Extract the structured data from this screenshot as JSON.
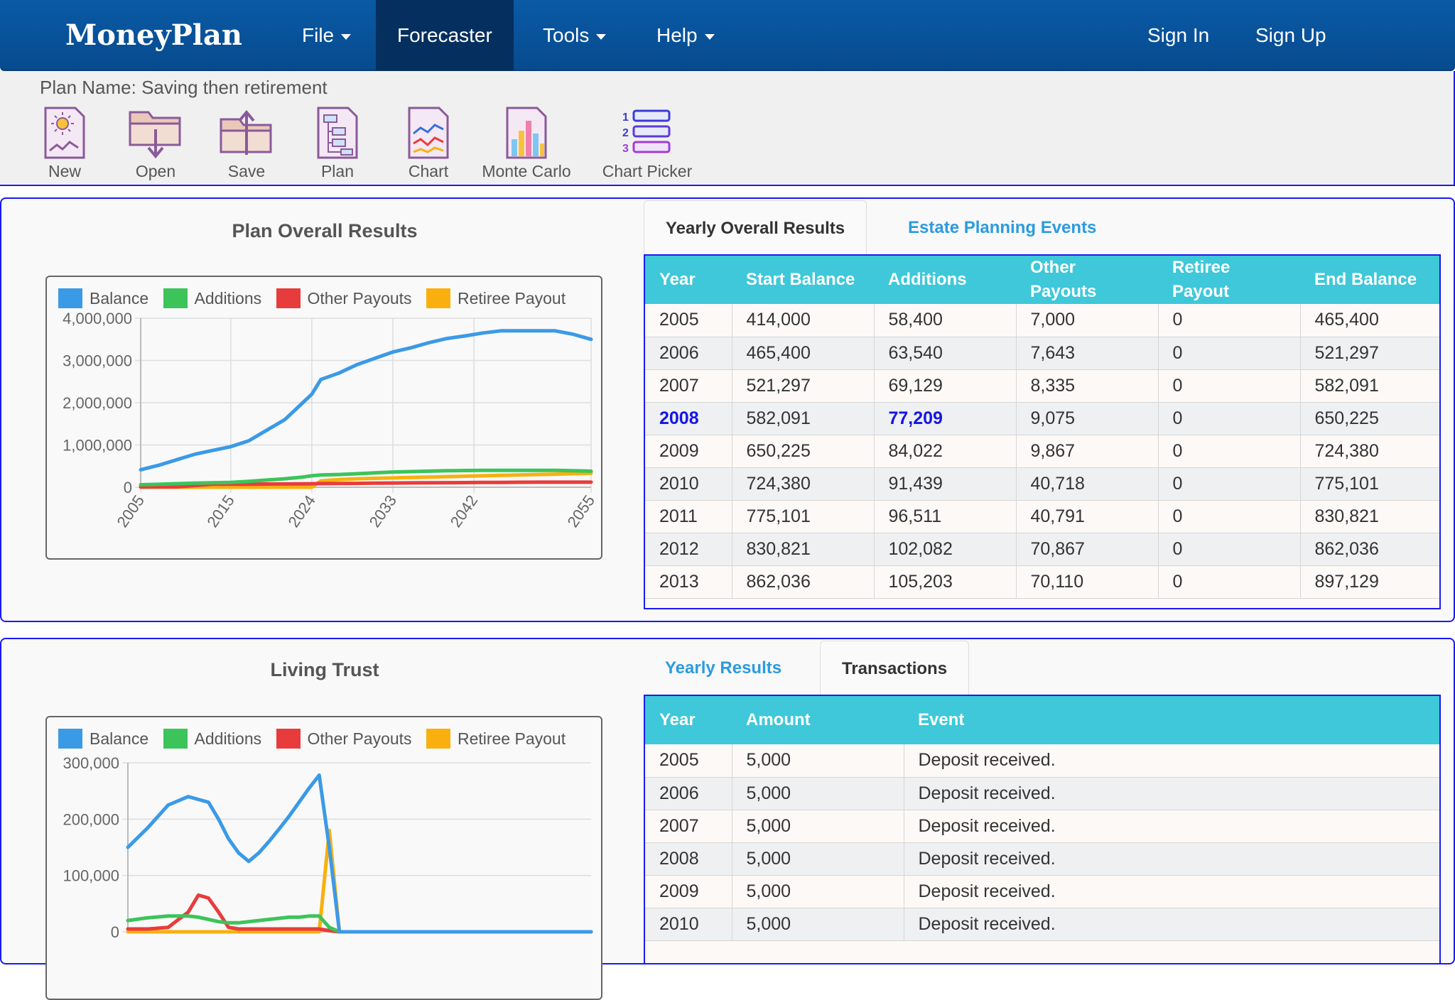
{
  "nav": {
    "brand": "MoneyPlan",
    "menu": [
      {
        "label": "File",
        "dropdown": true
      },
      {
        "label": "Forecaster",
        "dropdown": false,
        "active": true
      },
      {
        "label": "Tools",
        "dropdown": true
      },
      {
        "label": "Help",
        "dropdown": true
      }
    ],
    "sign_in": "Sign In",
    "sign_up": "Sign Up"
  },
  "toolbar": {
    "plan_name": "Plan Name: Saving then retirement",
    "tools": [
      {
        "label": "New",
        "icon": "new-plan-icon"
      },
      {
        "label": "Open",
        "icon": "open-folder-icon"
      },
      {
        "label": "Save",
        "icon": "save-folder-icon"
      },
      {
        "label": "Plan",
        "icon": "plan-doc-icon"
      },
      {
        "label": "Chart",
        "icon": "chart-doc-icon"
      },
      {
        "label": "Monte Carlo",
        "icon": "monte-carlo-icon"
      },
      {
        "label": "Chart Picker",
        "icon": "chart-picker-icon"
      }
    ]
  },
  "colors": {
    "balance": "#3b9ae6",
    "additions": "#3cc45a",
    "other_payouts": "#e83c3c",
    "retiree_payout": "#f9b00e",
    "table_header": "#3ec8d9",
    "nav": "#0a5aa6"
  },
  "overall": {
    "title": "Plan Overall Results",
    "tabs": [
      "Yearly Overall Results",
      "Estate Planning Events"
    ],
    "columns": [
      "Year",
      "Start Balance",
      "Additions",
      "Other Payouts",
      "Retiree Payout",
      "End Balance"
    ],
    "rows": [
      [
        "2005",
        "414,000",
        "58,400",
        "7,000",
        "0",
        "465,400"
      ],
      [
        "2006",
        "465,400",
        "63,540",
        "7,643",
        "0",
        "521,297"
      ],
      [
        "2007",
        "521,297",
        "69,129",
        "8,335",
        "0",
        "582,091"
      ],
      [
        "2008",
        "582,091",
        "77,209",
        "9,075",
        "0",
        "650,225"
      ],
      [
        "2009",
        "650,225",
        "84,022",
        "9,867",
        "0",
        "724,380"
      ],
      [
        "2010",
        "724,380",
        "91,439",
        "40,718",
        "0",
        "775,101"
      ],
      [
        "2011",
        "775,101",
        "96,511",
        "40,791",
        "0",
        "830,821"
      ],
      [
        "2012",
        "830,821",
        "102,082",
        "70,867",
        "0",
        "862,036"
      ],
      [
        "2013",
        "862,036",
        "105,203",
        "70,110",
        "0",
        "897,129"
      ]
    ]
  },
  "trust": {
    "title": "Living Trust",
    "tabs": [
      "Yearly Results",
      "Transactions"
    ],
    "columns": [
      "Year",
      "Amount",
      "Event"
    ],
    "rows": [
      [
        "2005",
        "5,000",
        "Deposit received."
      ],
      [
        "2006",
        "5,000",
        "Deposit received."
      ],
      [
        "2007",
        "5,000",
        "Deposit received."
      ],
      [
        "2008",
        "5,000",
        "Deposit received."
      ],
      [
        "2009",
        "5,000",
        "Deposit received."
      ],
      [
        "2010",
        "5,000",
        "Deposit received."
      ]
    ]
  },
  "chart_data": [
    {
      "type": "line",
      "title": "Plan Overall Results",
      "legend": [
        "Balance",
        "Additions",
        "Other Payouts",
        "Retiree Payout"
      ],
      "legend_position": "top-left",
      "x_tick_labels": [
        "2005",
        "2015",
        "2024",
        "2033",
        "2042",
        "2055"
      ],
      "y_tick_labels": [
        "0",
        "1,000,000",
        "2,000,000",
        "3,000,000",
        "4,000,000"
      ],
      "xlim": [
        2005,
        2055
      ],
      "ylim": [
        0,
        4000000
      ],
      "grid": true,
      "x": [
        2005,
        2007,
        2009,
        2011,
        2013,
        2015,
        2017,
        2019,
        2021,
        2023,
        2024,
        2025,
        2027,
        2029,
        2031,
        2033,
        2035,
        2037,
        2039,
        2041,
        2043,
        2045,
        2047,
        2049,
        2051,
        2053,
        2055
      ],
      "series": [
        {
          "name": "Balance",
          "values": [
            414000,
            520000,
            650000,
            780000,
            870000,
            960000,
            1100000,
            1350000,
            1600000,
            2000000,
            2200000,
            2550000,
            2700000,
            2900000,
            3050000,
            3200000,
            3300000,
            3420000,
            3520000,
            3580000,
            3650000,
            3700000,
            3700000,
            3700000,
            3700000,
            3620000,
            3500000
          ]
        },
        {
          "name": "Additions",
          "values": [
            58400,
            69000,
            84000,
            96000,
            105000,
            115000,
            140000,
            170000,
            200000,
            240000,
            270000,
            290000,
            300000,
            320000,
            340000,
            360000,
            370000,
            380000,
            390000,
            395000,
            400000,
            400000,
            400000,
            400000,
            400000,
            390000,
            380000
          ]
        },
        {
          "name": "Other Payouts",
          "values": [
            7000,
            8000,
            9000,
            40000,
            70000,
            70000,
            72000,
            75000,
            78000,
            80000,
            82000,
            85000,
            88000,
            90000,
            95000,
            100000,
            102000,
            105000,
            108000,
            110000,
            112000,
            115000,
            118000,
            120000,
            120000,
            120000,
            120000
          ]
        },
        {
          "name": "Retiree Payout",
          "values": [
            0,
            0,
            0,
            0,
            0,
            0,
            0,
            0,
            0,
            0,
            0,
            150000,
            180000,
            200000,
            210000,
            220000,
            230000,
            240000,
            250000,
            260000,
            270000,
            280000,
            290000,
            300000,
            310000,
            320000,
            330000
          ]
        }
      ]
    },
    {
      "type": "line",
      "title": "Living Trust",
      "legend": [
        "Balance",
        "Additions",
        "Other Payouts",
        "Retiree Payout"
      ],
      "legend_position": "top-left",
      "y_tick_labels": [
        "0",
        "100,000",
        "200,000",
        "300,000"
      ],
      "ylim": [
        0,
        300000
      ],
      "grid": true,
      "x": [
        2005,
        2007,
        2009,
        2011,
        2012,
        2013,
        2014,
        2015,
        2016,
        2017,
        2018,
        2019,
        2020,
        2021,
        2022,
        2023,
        2024,
        2025,
        2026,
        2027,
        2028,
        2029,
        2030,
        2033,
        2038,
        2043,
        2048,
        2051
      ],
      "series": [
        {
          "name": "Balance",
          "values": [
            150000,
            185000,
            225000,
            240000,
            235000,
            230000,
            200000,
            165000,
            140000,
            125000,
            140000,
            160000,
            182000,
            205000,
            230000,
            255000,
            278000,
            150000,
            0,
            0,
            0,
            0,
            0,
            0,
            0,
            0,
            0,
            0
          ]
        },
        {
          "name": "Additions",
          "values": [
            20000,
            25000,
            28000,
            28000,
            26000,
            22000,
            18000,
            16000,
            16000,
            18000,
            20000,
            22000,
            24000,
            26000,
            26000,
            28000,
            28000,
            8000,
            0,
            0,
            0,
            0,
            0,
            0,
            0,
            0,
            0,
            0
          ]
        },
        {
          "name": "Other Payouts",
          "values": [
            5000,
            5000,
            8000,
            35000,
            65000,
            60000,
            35000,
            8000,
            5000,
            5000,
            5000,
            5000,
            5000,
            5000,
            5000,
            5000,
            5000,
            2000,
            0,
            0,
            0,
            0,
            0,
            0,
            0,
            0,
            0,
            0
          ]
        },
        {
          "name": "Retiree Payout",
          "values": [
            0,
            0,
            0,
            0,
            0,
            0,
            0,
            0,
            0,
            0,
            0,
            0,
            0,
            0,
            0,
            0,
            0,
            180000,
            0,
            0,
            0,
            0,
            0,
            0,
            0,
            0,
            0,
            0
          ]
        }
      ]
    }
  ]
}
